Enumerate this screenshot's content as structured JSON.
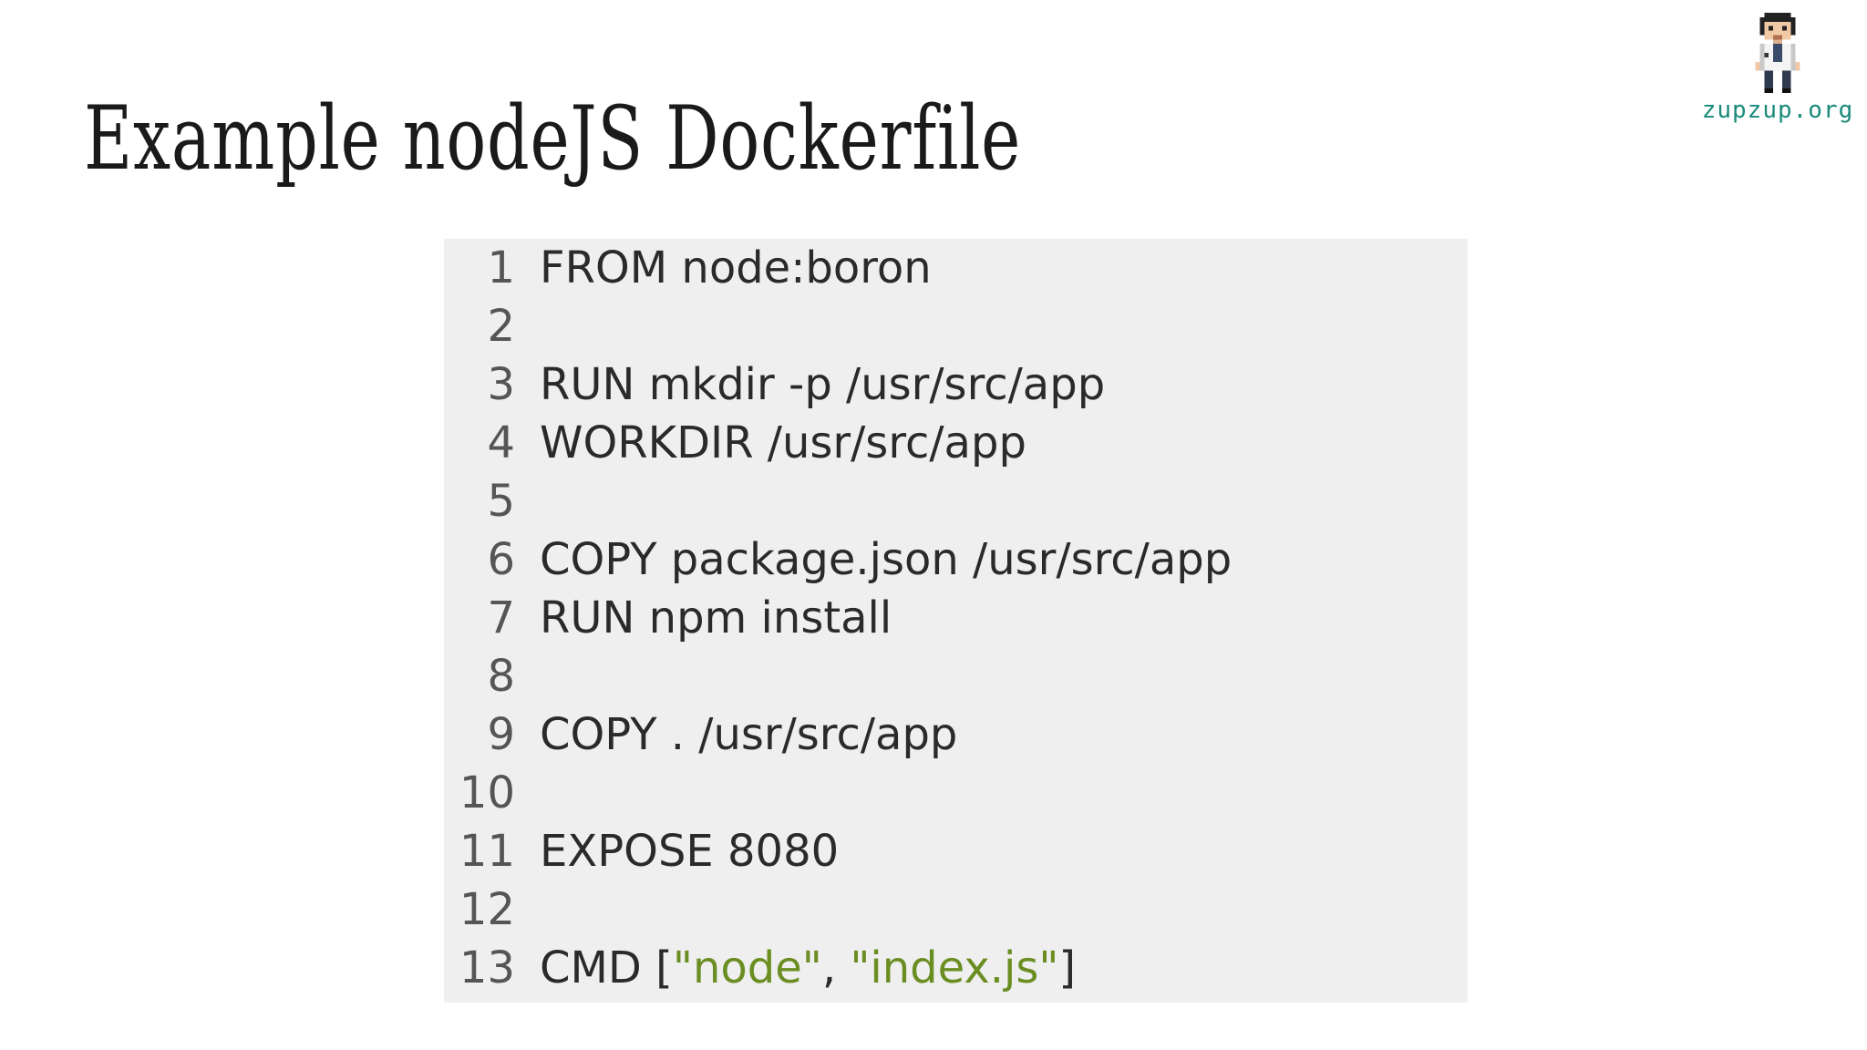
{
  "slide": {
    "title": "Example nodeJS Dockerfile"
  },
  "brand": {
    "text": "zupzup.org",
    "avatar_icon": "pixel-avatar-icon",
    "color": "#1a8a7a"
  },
  "code": {
    "language": "Dockerfile",
    "string_color": "#6b8e23",
    "lines": [
      {
        "num": "1",
        "text": "FROM node:boron"
      },
      {
        "num": "2",
        "text": ""
      },
      {
        "num": "3",
        "text": "RUN mkdir -p /usr/src/app"
      },
      {
        "num": "4",
        "text": "WORKDIR /usr/src/app"
      },
      {
        "num": "5",
        "text": ""
      },
      {
        "num": "6",
        "text": "COPY package.json /usr/src/app"
      },
      {
        "num": "7",
        "text": "RUN npm install"
      },
      {
        "num": "8",
        "text": ""
      },
      {
        "num": "9",
        "text": "COPY . /usr/src/app"
      },
      {
        "num": "10",
        "text": ""
      },
      {
        "num": "11",
        "text": "EXPOSE 8080"
      },
      {
        "num": "12",
        "text": ""
      },
      {
        "num": "13",
        "text": "CMD [\"node\", \"index.js\"]"
      }
    ]
  }
}
